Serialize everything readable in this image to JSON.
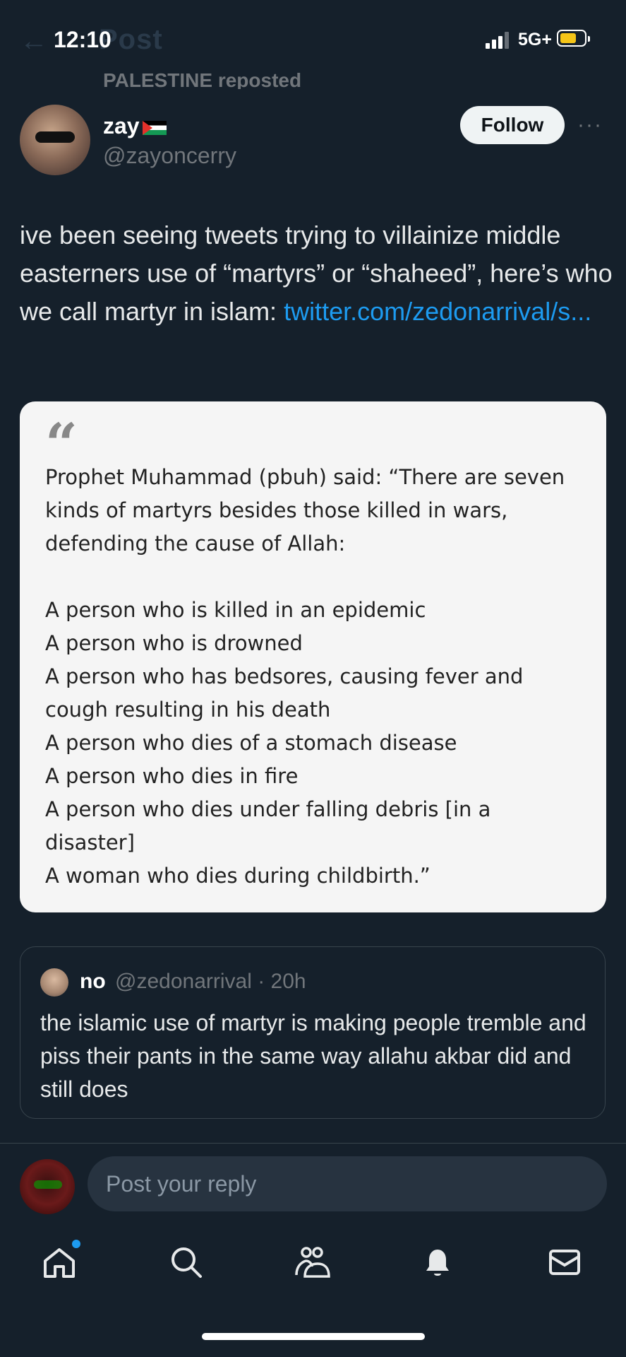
{
  "status_bar": {
    "time": "12:10",
    "network": "5G+",
    "ghost_title": "Post"
  },
  "repost": {
    "label": "PALESTINE reposted"
  },
  "author": {
    "display_name": "zay",
    "handle": "@zayoncerry",
    "follow_label": "Follow",
    "more_label": "···"
  },
  "tweet": {
    "text": "ive been seeing tweets trying to villainize middle easterners use of “martyrs” or “shaheed”, here’s who we call martyr in islam: ",
    "link": "twitter.com/zedonarrival/s..."
  },
  "quote_card": {
    "mark": "66",
    "lines": [
      "Prophet Muhammad (pbuh) said: “There are seven",
      "kinds of martyrs besides those killed in wars,",
      "defending the cause of Allah:",
      "",
      "A person who is killed in an epidemic",
      "A person who is drowned",
      "A person who has bedsores, causing fever and",
      "cough resulting in his death",
      "A person who dies of a stomach disease",
      "A person who dies in fire",
      "A person who dies under falling debris [in a",
      "disaster]",
      "A woman who dies during childbirth.”"
    ]
  },
  "quoted_tweet": {
    "name": "no",
    "handle_time": "@zedonarrival · 20h",
    "text": "the islamic use of martyr is making people tremble and piss their pants in the same way allahu akbar did and still does"
  },
  "reply": {
    "placeholder": "Post your reply"
  },
  "nav": [
    "home-icon",
    "search-icon",
    "communities-icon",
    "notifications-icon",
    "messages-icon"
  ],
  "colors": {
    "background": "#15202b",
    "link": "#1d9bf0",
    "muted": "#71767b"
  }
}
